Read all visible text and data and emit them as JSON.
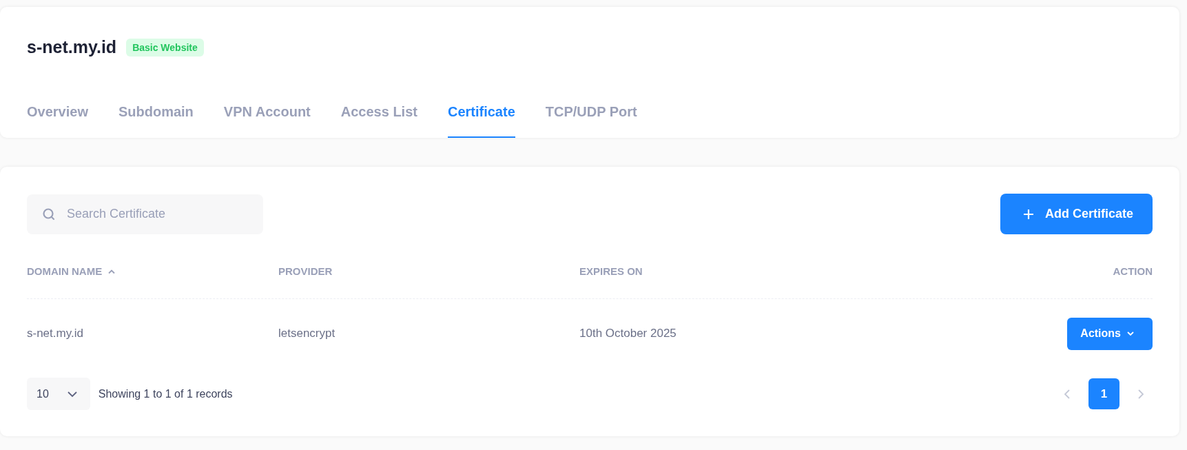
{
  "site": {
    "title": "s-net.my.id",
    "badge": "Basic Website"
  },
  "tabs": [
    {
      "label": "Overview",
      "selected": false
    },
    {
      "label": "Subdomain",
      "selected": false
    },
    {
      "label": "VPN Account",
      "selected": false
    },
    {
      "label": "Access List",
      "selected": false
    },
    {
      "label": "Certificate",
      "selected": true
    },
    {
      "label": "TCP/UDP Port",
      "selected": false
    }
  ],
  "search": {
    "placeholder": "Search Certificate"
  },
  "add_button": "Add Certificate",
  "table": {
    "columns": [
      {
        "label": "DOMAIN NAME",
        "sorted": true
      },
      {
        "label": "PROVIDER",
        "sorted": false
      },
      {
        "label": "EXPIRES ON",
        "sorted": false
      },
      {
        "label": "ACTION",
        "sorted": false
      }
    ],
    "rows": [
      {
        "domain": "s-net.my.id",
        "provider": "letsencrypt",
        "expires": "10th October 2025",
        "action": "Actions"
      }
    ]
  },
  "footer": {
    "page_size": "10",
    "summary": "Showing 1 to 1 of 1 records",
    "pages": [
      {
        "label": "1",
        "selected": true
      }
    ]
  }
}
